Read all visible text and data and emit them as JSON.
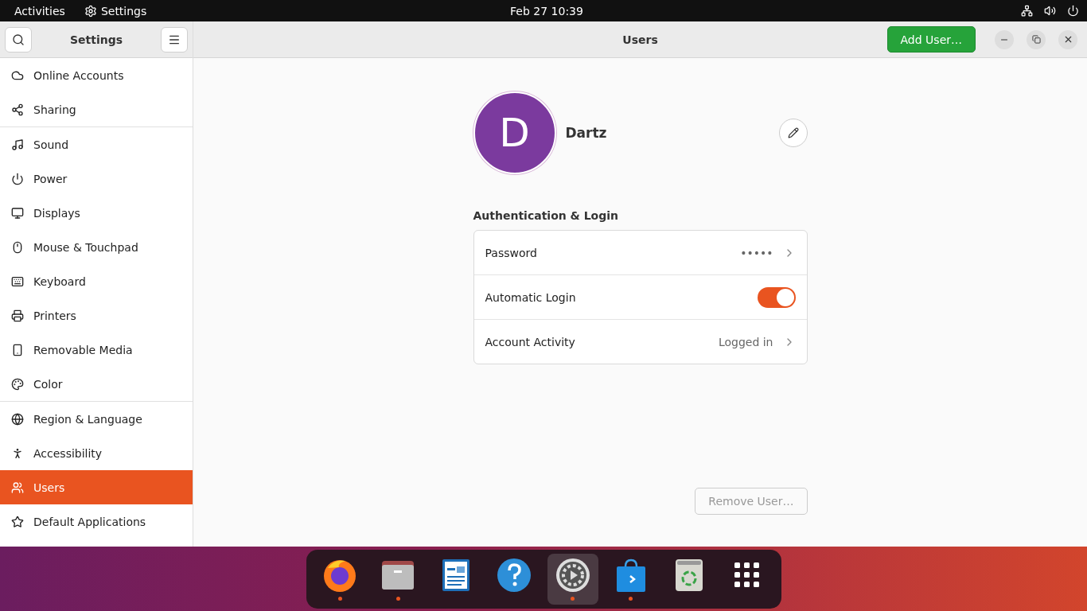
{
  "top_bar": {
    "activities": "Activities",
    "app_name": "Settings",
    "clock": "Feb 27  10:39"
  },
  "sidebar": {
    "title": "Settings",
    "groups": [
      [
        {
          "label": "Online Accounts",
          "selected": false
        },
        {
          "label": "Sharing",
          "selected": false
        }
      ],
      [
        {
          "label": "Sound",
          "selected": false
        },
        {
          "label": "Power",
          "selected": false
        },
        {
          "label": "Displays",
          "selected": false
        },
        {
          "label": "Mouse & Touchpad",
          "selected": false
        },
        {
          "label": "Keyboard",
          "selected": false
        },
        {
          "label": "Printers",
          "selected": false
        },
        {
          "label": "Removable Media",
          "selected": false
        },
        {
          "label": "Color",
          "selected": false
        }
      ],
      [
        {
          "label": "Region & Language",
          "selected": false
        },
        {
          "label": "Accessibility",
          "selected": false
        },
        {
          "label": "Users",
          "selected": true
        },
        {
          "label": "Default Applications",
          "selected": false
        }
      ]
    ]
  },
  "header": {
    "title": "Users",
    "add_button": "Add User…"
  },
  "user": {
    "initial": "D",
    "name": "Dartz"
  },
  "section_title": "Authentication & Login",
  "rows": [
    {
      "kind": "link",
      "label": "Password",
      "value": "•••••"
    },
    {
      "kind": "switch",
      "label": "Automatic Login",
      "on": true
    },
    {
      "kind": "link",
      "label": "Account Activity",
      "value": "Logged in"
    }
  ],
  "remove_button": {
    "label": "Remove User…",
    "disabled": true
  },
  "dock": [
    {
      "running": true,
      "selected": false
    },
    {
      "running": true,
      "selected": false
    },
    {
      "running": false,
      "selected": false
    },
    {
      "running": false,
      "selected": false
    },
    {
      "running": true,
      "selected": true
    },
    {
      "running": true,
      "selected": false
    },
    {
      "running": false,
      "selected": false
    },
    {
      "running": false,
      "selected": false
    }
  ]
}
